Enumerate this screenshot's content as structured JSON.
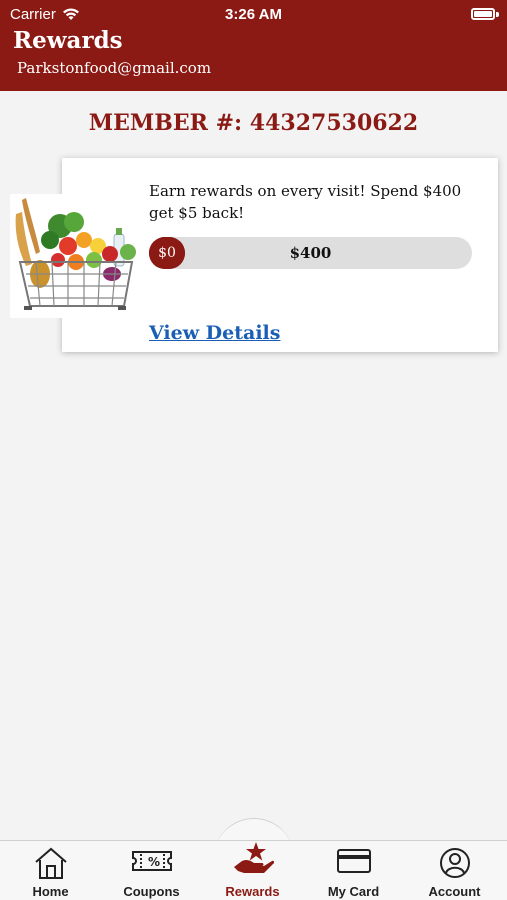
{
  "status_bar": {
    "carrier": "Carrier",
    "time": "3:26 AM"
  },
  "header": {
    "title": "Rewards",
    "email": "Parkstonfood@gmail.com"
  },
  "member": {
    "label": "MEMBER #: 44327530622"
  },
  "reward": {
    "description": "Earn rewards on every visit! Spend $400 get $5 back!",
    "progress_start": "$0",
    "progress_goal": "$400",
    "progress_fraction": 0,
    "details_link": "View Details",
    "image_icon": "grocery-basket-image"
  },
  "tabs": [
    {
      "label": "Home",
      "icon": "home-icon"
    },
    {
      "label": "Coupons",
      "icon": "coupon-icon"
    },
    {
      "label": "Rewards",
      "icon": "rewards-icon",
      "active": true
    },
    {
      "label": "My Card",
      "icon": "card-icon"
    },
    {
      "label": "Account",
      "icon": "account-icon"
    }
  ],
  "colors": {
    "brand": "#8b1a14",
    "link": "#1a5fb4",
    "background": "#f3f3f3"
  }
}
